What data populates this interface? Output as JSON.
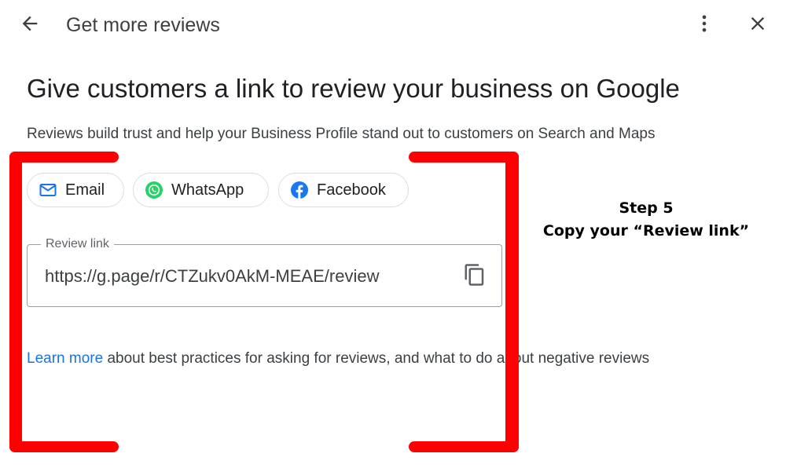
{
  "header": {
    "title": "Get more reviews",
    "back_icon": "arrow-back-icon",
    "more_icon": "more-vert-icon",
    "close_icon": "close-icon"
  },
  "main": {
    "title": "Give customers a link to review your business on Google",
    "subtitle": "Reviews build trust and help your Business Profile stand out to customers on Search and Maps"
  },
  "share_options": [
    {
      "label": "Email",
      "icon": "email-icon",
      "color": "#1a73e8"
    },
    {
      "label": "WhatsApp",
      "icon": "whatsapp-icon",
      "color": "#25d366"
    },
    {
      "label": "Facebook",
      "icon": "facebook-icon",
      "color": "#1877f2"
    }
  ],
  "review_link": {
    "label": "Review link",
    "value": "https://g.page/r/CTZukv0AkM-MEAE/review",
    "copy_icon": "copy-icon"
  },
  "learn_more": {
    "link_text": "Learn more",
    "text": " about best practices for asking for reviews, and what to do about negative reviews"
  },
  "annotation": {
    "step": "Step 5",
    "instruction": "Copy your “Review link”",
    "bracket_color": "#ff0000"
  }
}
